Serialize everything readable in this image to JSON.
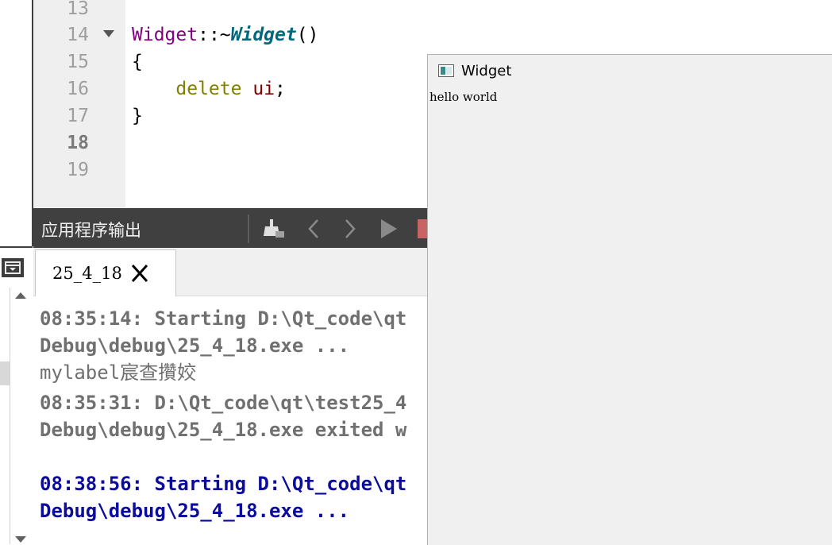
{
  "editor": {
    "line_numbers": [
      "13",
      "14",
      "15",
      "16",
      "17",
      "18",
      "19"
    ],
    "current_line": "18",
    "code": {
      "line14_class": "Widget",
      "line14_sep": "::~",
      "line14_func": "Widget",
      "line14_parens": "()",
      "line15": "{",
      "line16_indent": "    ",
      "line16_kw": "delete",
      "line16_space": " ",
      "line16_var": "ui",
      "line16_semi": ";",
      "line17": "}"
    }
  },
  "output_pane": {
    "title": "应用程序输出",
    "toolbar_icons": [
      "clear-icon",
      "prev-icon",
      "next-icon",
      "run-icon",
      "stop-icon"
    ],
    "tab": {
      "label": "25_4_18",
      "close_icon": "close-icon"
    },
    "lines": [
      {
        "text": "08:35:14: Starting D:\\Qt_code\\qt",
        "style": "gray"
      },
      {
        "text": "Debug\\debug\\25_4_18.exe ...",
        "style": "gray"
      },
      {
        "text": "mylabel宸查攢姣",
        "style": "gray-normal"
      },
      {
        "text": "08:35:31: D:\\Qt_code\\qt\\test25_4",
        "style": "gray"
      },
      {
        "text": "Debug\\debug\\25_4_18.exe exited w",
        "style": "gray"
      },
      {
        "text": "",
        "style": "gray"
      },
      {
        "text": "08:38:56: Starting D:\\Qt_code\\qt",
        "style": "blue"
      },
      {
        "text": "Debug\\debug\\25_4_18.exe ...",
        "style": "blue"
      }
    ]
  },
  "widget_window": {
    "title": "Widget",
    "label": "hello world"
  },
  "colors": {
    "toolbar_bg": "#404040",
    "keyword": "#808000",
    "class": "#800080",
    "function": "#00677c",
    "variable": "#800000",
    "output_gray": "#707070",
    "output_blue": "#0c0c9c"
  }
}
